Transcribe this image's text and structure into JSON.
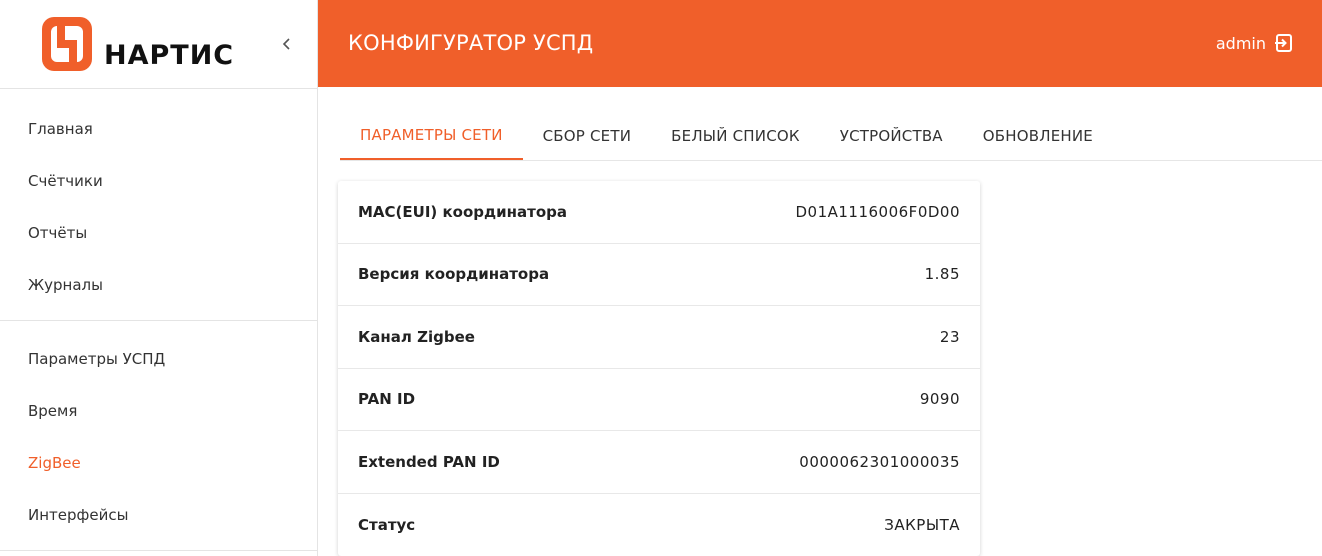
{
  "brand": {
    "name": "НАРТИС",
    "accent": "#f05f2a"
  },
  "sidebar": {
    "group1": [
      {
        "label": "Главная"
      },
      {
        "label": "Счётчики"
      },
      {
        "label": "Отчёты"
      },
      {
        "label": "Журналы"
      }
    ],
    "group2": [
      {
        "label": "Параметры УСПД"
      },
      {
        "label": "Время"
      },
      {
        "label": "ZigBee",
        "active": true
      },
      {
        "label": "Интерфейсы"
      }
    ]
  },
  "header": {
    "title": "КОНФИГУРАТОР УСПД",
    "user": "admin",
    "logout_icon": "logout-icon"
  },
  "tabs": [
    {
      "label": "ПАРАМЕТРЫ СЕТИ",
      "active": true
    },
    {
      "label": "СБОР СЕТИ"
    },
    {
      "label": "БЕЛЫЙ СПИСОК"
    },
    {
      "label": "УСТРОЙСТВА"
    },
    {
      "label": "ОБНОВЛЕНИЕ"
    }
  ],
  "params": [
    {
      "label": "MAC(EUI) координатора",
      "value": "D01A1116006F0D00"
    },
    {
      "label": "Версия координатора",
      "value": "1.85"
    },
    {
      "label": "Канал Zigbee",
      "value": "23"
    },
    {
      "label": "PAN ID",
      "value": "9090"
    },
    {
      "label": "Extended PAN ID",
      "value": "0000062301000035"
    },
    {
      "label": "Статус",
      "value": "ЗАКРЫТА"
    }
  ]
}
